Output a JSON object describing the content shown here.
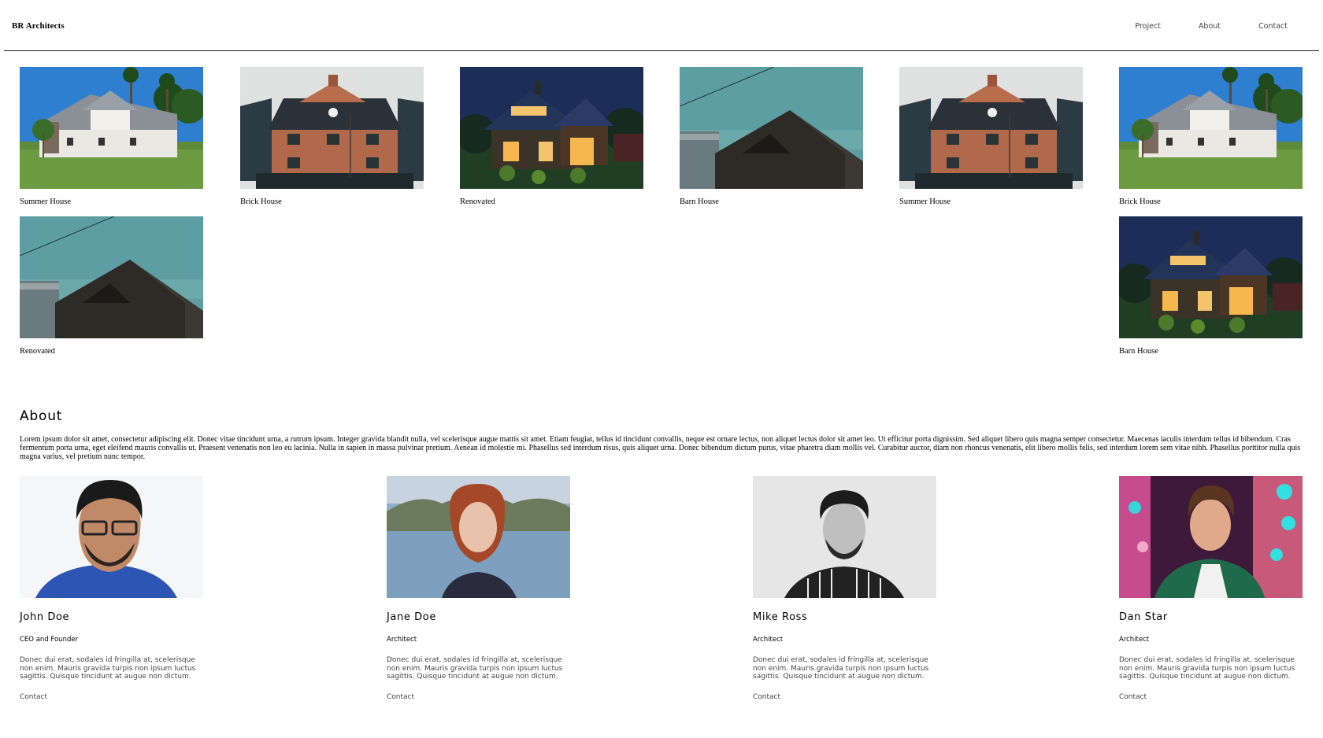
{
  "header": {
    "brand": "BR Architects",
    "nav": [
      "Project",
      "About",
      "Contact"
    ]
  },
  "gallery": [
    {
      "caption": "Summer House",
      "image": "white-summer-house-with-palms"
    },
    {
      "caption": "Brick House",
      "image": "brick-house-with-chimneys"
    },
    {
      "caption": "Renovated",
      "image": "lit-house-at-dusk"
    },
    {
      "caption": "Barn House",
      "image": "dark-wood-barn-roof-teal-sky"
    },
    {
      "caption": "Summer House",
      "image": "brick-house-with-chimneys"
    },
    {
      "caption": "Brick House",
      "image": "white-summer-house-with-palms"
    },
    {
      "caption": "Renovated",
      "image": "dark-wood-barn-roof-teal-sky"
    },
    {
      "caption": "Barn House",
      "image": "lit-house-at-dusk"
    }
  ],
  "about": {
    "title": "About",
    "text": "Lorem ipsum dolor sit amet, consectetur adipiscing elit. Donec vitae tincidunt urna, a rutrum ipsum. Integer gravida blandit nulla, vel scelerisque augue mattis sit amet. Etiam feugiat, tellus id tincidunt convallis, neque est ornare lectus, non aliquet lectus dolor sit amet leo. Ut efficitur porta dignissim. Sed aliquet libero quis magna semper consectetur. Maecenas iaculis interdum tellus id bibendum. Cras fermentum porta urna, eget eleifend mauris convallis ut. Praesent venenatis non leo eu lacinia. Nulla in sapien in massa pulvinar pretium. Aenean id molestie mi. Phasellus sed interdum risus, quis aliquet urna. Donec bibendum dictum purus, vitae pharetra diam mollis vel. Curabitur auctor, diam non rhoncus venenatis, elit libero mollis felis, sed interdum lorem sem vitae nibh. Phasellus porttitor nulla quis magna varius, vel pretium nunc tempor."
  },
  "team": [
    {
      "name": "John Doe",
      "role": "CEO and Founder",
      "bio": "Donec dui erat, sodales id fringilla at, scelerisque non enim. Mauris gravida turpis non ipsum luctus sagittis. Quisque tincidunt at augue non dictum.",
      "contact": "Contact"
    },
    {
      "name": "Jane Doe",
      "role": "Architect",
      "bio": "Donec dui erat, sodales id fringilla at, scelerisque non enim. Mauris gravida turpis non ipsum luctus sagittis. Quisque tincidunt at augue non dictum.",
      "contact": "Contact"
    },
    {
      "name": "Mike Ross",
      "role": "Architect",
      "bio": "Donec dui erat, sodales id fringilla at, scelerisque non enim. Mauris gravida turpis non ipsum luctus sagittis. Quisque tincidunt at augue non dictum.",
      "contact": "Contact"
    },
    {
      "name": "Dan Star",
      "role": "Architect",
      "bio": "Donec dui erat, sodales id fringilla at, scelerisque non enim. Mauris gravida turpis non ipsum luctus sagittis. Quisque tincidunt at augue non dictum.",
      "contact": "Contact"
    }
  ]
}
